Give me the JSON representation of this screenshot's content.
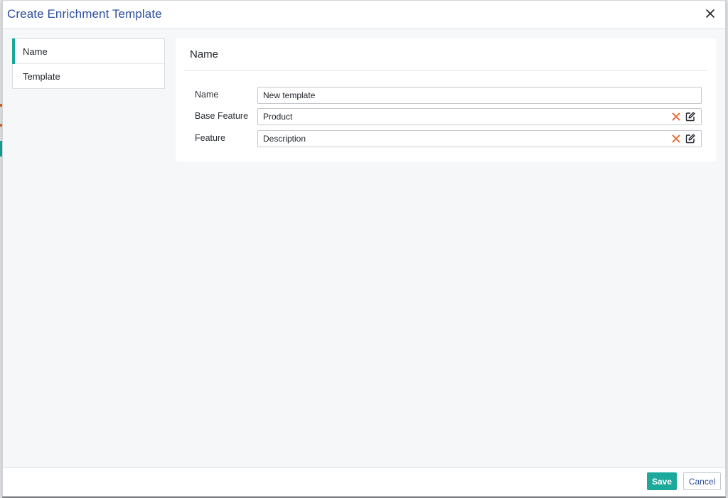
{
  "dialog": {
    "title": "Create Enrichment Template"
  },
  "nav": {
    "items": [
      {
        "label": "Name",
        "active": true
      },
      {
        "label": "Template",
        "active": false
      }
    ]
  },
  "panel": {
    "title": "Name",
    "fields": [
      {
        "label": "Name",
        "value": "New template"
      },
      {
        "label": "Base Feature",
        "value": "Product"
      },
      {
        "label": "Feature",
        "value": "Description"
      }
    ]
  },
  "footer": {
    "save_label": "Save",
    "cancel_label": "Cancel"
  },
  "colors": {
    "accent": "#1ba99b",
    "title": "#2b4f9e",
    "clear_icon": "#e8733a"
  },
  "icons": {
    "close": "close-icon",
    "clear": "clear-x-icon",
    "edit": "edit-icon"
  }
}
